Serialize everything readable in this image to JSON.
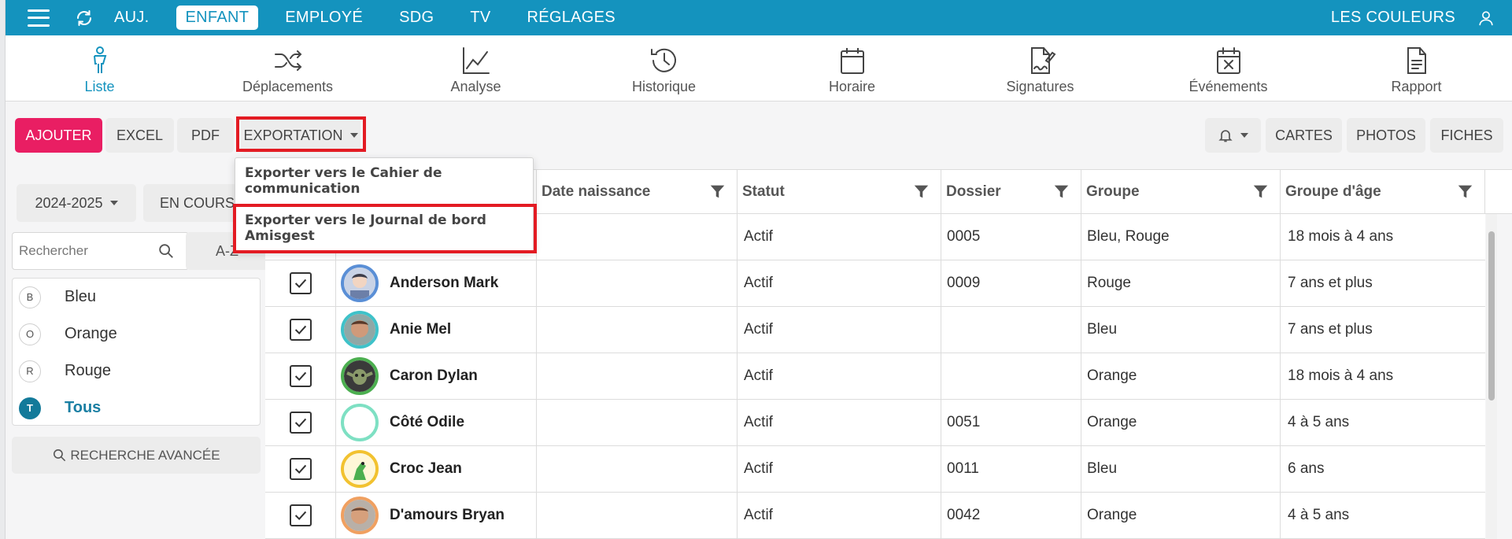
{
  "topnav": {
    "links": [
      "AUJ.",
      "ENFANT",
      "EMPLOYÉ",
      "SDG",
      "TV",
      "RÉGLAGES"
    ],
    "active": "ENFANT",
    "right_label": "LES COULEURS",
    "bg_color": "#1493be"
  },
  "subnav": {
    "items": [
      {
        "label": "Liste",
        "icon": "person-icon",
        "active": true
      },
      {
        "label": "Déplacements",
        "icon": "shuffle-icon"
      },
      {
        "label": "Analyse",
        "icon": "chart-line-icon"
      },
      {
        "label": "Historique",
        "icon": "history-icon"
      },
      {
        "label": "Horaire",
        "icon": "calendar-icon"
      },
      {
        "label": "Signatures",
        "icon": "signature-icon"
      },
      {
        "label": "Événements",
        "icon": "calendar-x-icon"
      },
      {
        "label": "Rapport",
        "icon": "document-icon"
      }
    ]
  },
  "toolbar": {
    "add": "AJOUTER",
    "excel": "EXCEL",
    "pdf": "PDF",
    "export": "EXPORTATION",
    "cartes": "CARTES",
    "photos": "PHOTOS",
    "fiches": "FICHES",
    "add_color": "#e91e63"
  },
  "export_menu": {
    "items": [
      "Exporter vers le Cahier de communication",
      "Exporter vers le Journal de bord Amisgest"
    ]
  },
  "left": {
    "year": "2024-2025",
    "status": "EN COURS",
    "search_placeholder": "Rechercher",
    "sort": "A-Z",
    "groups": [
      {
        "letter": "B",
        "name": "Bleu"
      },
      {
        "letter": "O",
        "name": "Orange"
      },
      {
        "letter": "R",
        "name": "Rouge"
      },
      {
        "letter": "T",
        "name": "Tous",
        "selected": true
      }
    ],
    "advanced": "RECHERCHE AVANCÉE"
  },
  "table": {
    "headers": [
      "Date naissance",
      "Statut",
      "Dossier",
      "Groupe",
      "Groupe d'âge"
    ],
    "rows": [
      {
        "name": "",
        "status": "Actif",
        "dossier": "0005",
        "group": "Bleu, Rouge",
        "age": "18 mois à 4 ans",
        "avatar_color": "#5a8fd6"
      },
      {
        "name": "Anderson Mark",
        "status": "Actif",
        "dossier": "0009",
        "group": "Rouge",
        "age": "7 ans et plus",
        "avatar_color": "#5a8fd6"
      },
      {
        "name": "Anie Mel",
        "status": "Actif",
        "dossier": "",
        "group": "Bleu",
        "age": "7 ans et plus",
        "avatar_color": "#3fc2c9"
      },
      {
        "name": "Caron Dylan",
        "status": "Actif",
        "dossier": "",
        "group": "Orange",
        "age": "18 mois à 4 ans",
        "avatar_color": "#4caf50"
      },
      {
        "name": "Côté Odile",
        "status": "Actif",
        "dossier": "0051",
        "group": "Orange",
        "age": "4 à 5 ans",
        "avatar_color": "#7ee0c3"
      },
      {
        "name": "Croc Jean",
        "status": "Actif",
        "dossier": "0011",
        "group": "Bleu",
        "age": "6 ans",
        "avatar_color": "#f2c230"
      },
      {
        "name": "D'amours Bryan",
        "status": "Actif",
        "dossier": "0042",
        "group": "Orange",
        "age": "4 à 5 ans",
        "avatar_color": "#f0a060"
      }
    ]
  }
}
